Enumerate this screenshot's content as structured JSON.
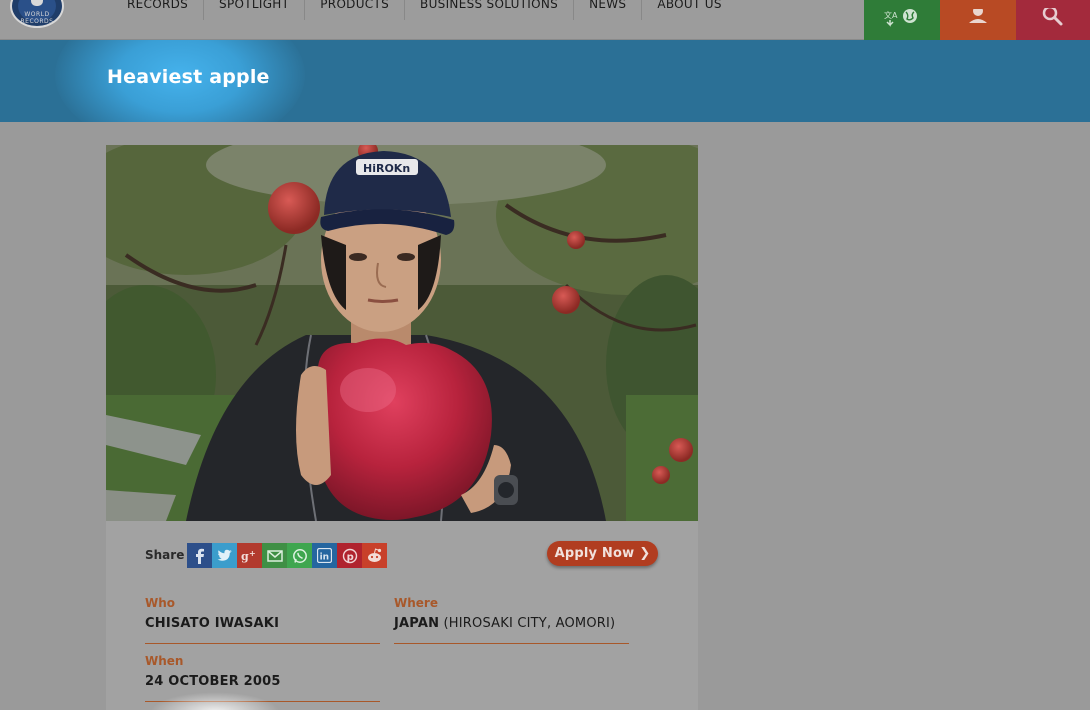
{
  "header": {
    "nav": [
      "RECORDS",
      "SPOTLIGHT",
      "PRODUCTS",
      "BUSINESS SOLUTIONS",
      "NEWS",
      "ABOUT US"
    ],
    "tiles": [
      {
        "icon": "language-globe-icon",
        "color": "#2f7c38"
      },
      {
        "icon": "user-icon",
        "color": "#b84a24"
      },
      {
        "icon": "search-icon",
        "color": "#a32a3c"
      }
    ]
  },
  "logo": {
    "text": "WORLD RECORDS"
  },
  "page": {
    "title": "Heaviest apple"
  },
  "share": {
    "label": "Share",
    "buttons": [
      {
        "name": "facebook",
        "glyph": "f",
        "color": "#2d4f8a"
      },
      {
        "name": "twitter",
        "glyph": "t",
        "color": "#3b9dcc"
      },
      {
        "name": "google-plus",
        "glyph": "g+",
        "color": "#b23a2e"
      },
      {
        "name": "email",
        "glyph": "mail",
        "color": "#3f8f45"
      },
      {
        "name": "whatsapp",
        "glyph": "wa",
        "color": "#3fa64f"
      },
      {
        "name": "linkedin",
        "glyph": "in",
        "color": "#2566a0"
      },
      {
        "name": "pinterest",
        "glyph": "p",
        "color": "#b0232e"
      },
      {
        "name": "reddit",
        "glyph": "r",
        "color": "#c8402a"
      }
    ]
  },
  "apply": {
    "label": "Apply Now"
  },
  "details": {
    "who": {
      "label": "Who",
      "value": "CHISATO IWASAKI"
    },
    "where": {
      "label": "Where",
      "country": "JAPAN",
      "place": "(HIROSAKI CITY, AOMORI)"
    },
    "when": {
      "label": "When",
      "value": "24 OCTOBER 2005"
    }
  },
  "photo": {
    "cap_text": "HiROKn"
  },
  "colors": {
    "banner": "#2b7096",
    "accent_label": "#a8582a",
    "apply_button": "#b13d20"
  }
}
